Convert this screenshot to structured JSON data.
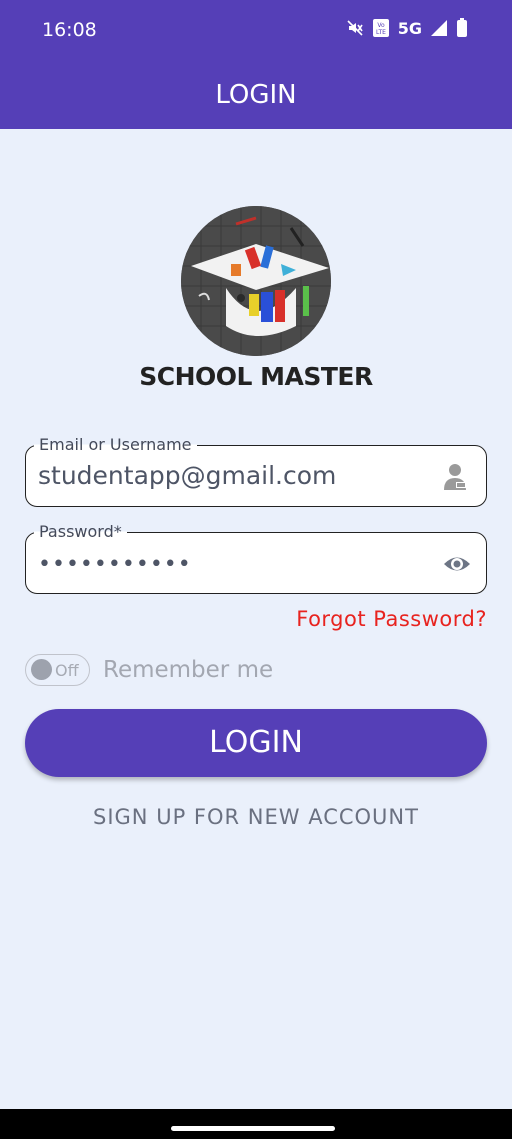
{
  "status_bar": {
    "time": "16:08",
    "network": "5G",
    "icons": [
      "mute-icon",
      "volte-icon",
      "signal-icon",
      "battery-icon"
    ]
  },
  "app_bar": {
    "title": "LOGIN"
  },
  "brand": {
    "name": "SCHOOL MASTER"
  },
  "email_field": {
    "label": "Email or Username",
    "value": "studentapp@gmail.com",
    "icon": "student-icon"
  },
  "password_field": {
    "label": "Password*",
    "value": "•••••••••••",
    "icon": "eye-icon"
  },
  "forgot_password": "Forgot Password?",
  "remember": {
    "toggle_text": "Off",
    "label": "Remember me"
  },
  "login_button": "LOGIN",
  "signup_link": "SIGN UP FOR NEW ACCOUNT",
  "colors": {
    "primary": "#553fb7",
    "background": "#eaf0fb",
    "error": "#e8231f"
  }
}
